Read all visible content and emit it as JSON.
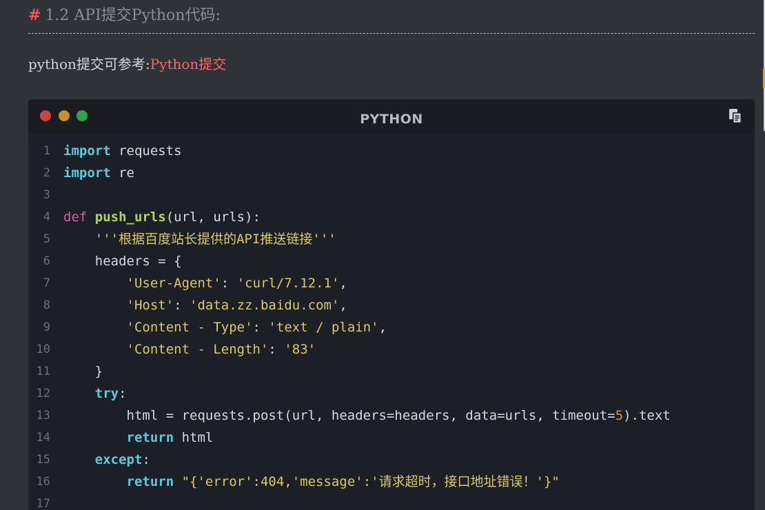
{
  "heading": {
    "hash": "#",
    "text": "1.2 API提交Python代码:"
  },
  "intro": {
    "prefix": "python提交可参考:",
    "link_text": "Python提交"
  },
  "code_block": {
    "language": "PYTHON",
    "copy_icon": "copy-icon",
    "window_dots": [
      "#c9453f",
      "#c9902a",
      "#2fa44a"
    ],
    "lines": [
      {
        "n": "1",
        "tokens": [
          {
            "t": "import",
            "c": "kw"
          },
          {
            "t": " requests",
            "c": ""
          }
        ]
      },
      {
        "n": "2",
        "tokens": [
          {
            "t": "import",
            "c": "kw"
          },
          {
            "t": " re",
            "c": ""
          }
        ]
      },
      {
        "n": "3",
        "tokens": []
      },
      {
        "n": "4",
        "tokens": [
          {
            "t": "def",
            "c": "kw2"
          },
          {
            "t": " ",
            "c": ""
          },
          {
            "t": "push_urls",
            "c": "fn"
          },
          {
            "t": "(url, urls):",
            "c": ""
          }
        ]
      },
      {
        "n": "5",
        "tokens": [
          {
            "t": "    ",
            "c": ""
          },
          {
            "t": "'''根据百度站长提供的API推送链接'''",
            "c": "str"
          }
        ]
      },
      {
        "n": "6",
        "tokens": [
          {
            "t": "    headers = {",
            "c": ""
          }
        ]
      },
      {
        "n": "7",
        "tokens": [
          {
            "t": "        ",
            "c": ""
          },
          {
            "t": "'User-Agent'",
            "c": "str"
          },
          {
            "t": ": ",
            "c": ""
          },
          {
            "t": "'curl/7.12.1'",
            "c": "str"
          },
          {
            "t": ",",
            "c": ""
          }
        ]
      },
      {
        "n": "8",
        "tokens": [
          {
            "t": "        ",
            "c": ""
          },
          {
            "t": "'Host'",
            "c": "str"
          },
          {
            "t": ": ",
            "c": ""
          },
          {
            "t": "'data.zz.baidu.com'",
            "c": "str"
          },
          {
            "t": ",",
            "c": ""
          }
        ]
      },
      {
        "n": "9",
        "tokens": [
          {
            "t": "        ",
            "c": ""
          },
          {
            "t": "'Content - Type'",
            "c": "str"
          },
          {
            "t": ": ",
            "c": ""
          },
          {
            "t": "'text / plain'",
            "c": "str"
          },
          {
            "t": ",",
            "c": ""
          }
        ]
      },
      {
        "n": "10",
        "tokens": [
          {
            "t": "        ",
            "c": ""
          },
          {
            "t": "'Content - Length'",
            "c": "str"
          },
          {
            "t": ": ",
            "c": ""
          },
          {
            "t": "'83'",
            "c": "str"
          }
        ]
      },
      {
        "n": "11",
        "tokens": [
          {
            "t": "    }",
            "c": ""
          }
        ]
      },
      {
        "n": "12",
        "tokens": [
          {
            "t": "    ",
            "c": ""
          },
          {
            "t": "try",
            "c": "kw"
          },
          {
            "t": ":",
            "c": ""
          }
        ]
      },
      {
        "n": "13",
        "tokens": [
          {
            "t": "        html = requests.post(url, headers=headers, data=urls, timeout=",
            "c": ""
          },
          {
            "t": "5",
            "c": "num"
          },
          {
            "t": ").text",
            "c": ""
          }
        ]
      },
      {
        "n": "14",
        "tokens": [
          {
            "t": "        ",
            "c": ""
          },
          {
            "t": "return",
            "c": "kw"
          },
          {
            "t": " html",
            "c": ""
          }
        ]
      },
      {
        "n": "15",
        "tokens": [
          {
            "t": "    ",
            "c": ""
          },
          {
            "t": "except",
            "c": "kw"
          },
          {
            "t": ":",
            "c": ""
          }
        ]
      },
      {
        "n": "16",
        "tokens": [
          {
            "t": "        ",
            "c": ""
          },
          {
            "t": "return",
            "c": "kw"
          },
          {
            "t": " \"{'error':404,'message':'请求超时，接口地址错误！'}\"",
            "c": "str"
          }
        ]
      },
      {
        "n": "17",
        "tokens": []
      }
    ]
  },
  "colors": {
    "page_bg": "#2f3237",
    "code_bg": "#1d1f27",
    "link": "#f06a6e",
    "keyword": "#66c5d8",
    "def_keyword": "#d05f9a",
    "function_name": "#b4d455",
    "string": "#d8c96a",
    "number": "#d68a4b"
  }
}
